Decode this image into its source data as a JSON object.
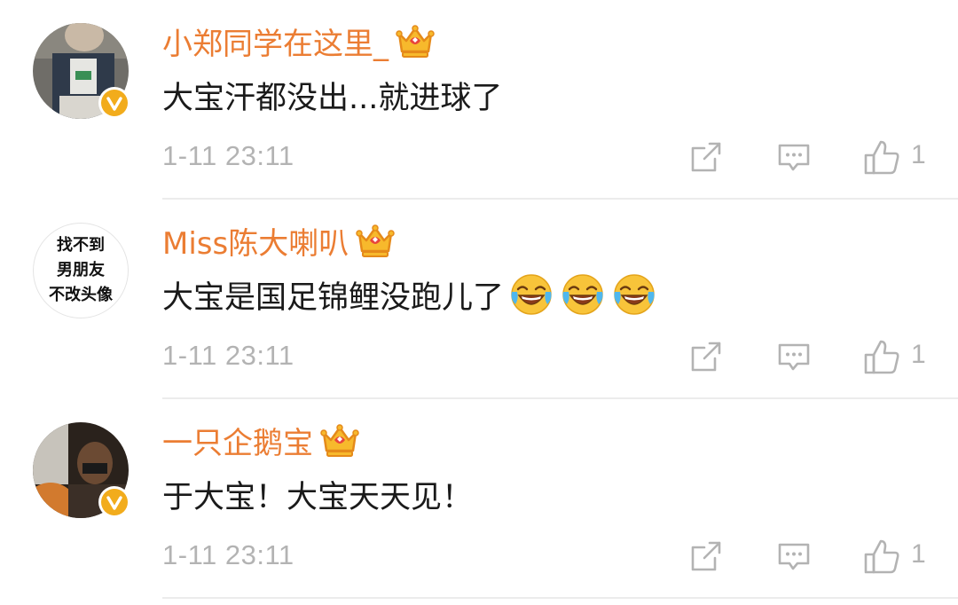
{
  "comments": [
    {
      "username": "小郑同学在这里_",
      "text": "大宝汗都没出...就进球了",
      "timestamp": "1-11 23:11",
      "likes": "1",
      "verified": true,
      "avatar": "photo-boy-denim"
    },
    {
      "username": "Miss陈大喇叭",
      "text": "大宝是国足锦鲤没跑儿了",
      "timestamp": "1-11 23:11",
      "likes": "1",
      "verified": false,
      "avatar_lines": [
        "找不到",
        "男朋友",
        "不改头像"
      ],
      "emojis": [
        "laughing-crying-emoji",
        "laughing-crying-emoji",
        "laughing-crying-emoji"
      ]
    },
    {
      "username": "一只企鹅宝",
      "text": "于大宝！大宝天天见！",
      "timestamp": "1-11 23:11",
      "likes": "1",
      "verified": true,
      "avatar": "photo-man-car"
    }
  ],
  "colors": {
    "username": "#eb7d33",
    "text": "#1a1a1a",
    "meta": "#b3b3b3",
    "verified_badge": "#f2ac1c",
    "divider": "#ececec"
  },
  "icons": {
    "crown": "crown-vip-icon",
    "share": "share-icon",
    "reply": "comment-icon",
    "like": "thumbs-up-icon"
  }
}
